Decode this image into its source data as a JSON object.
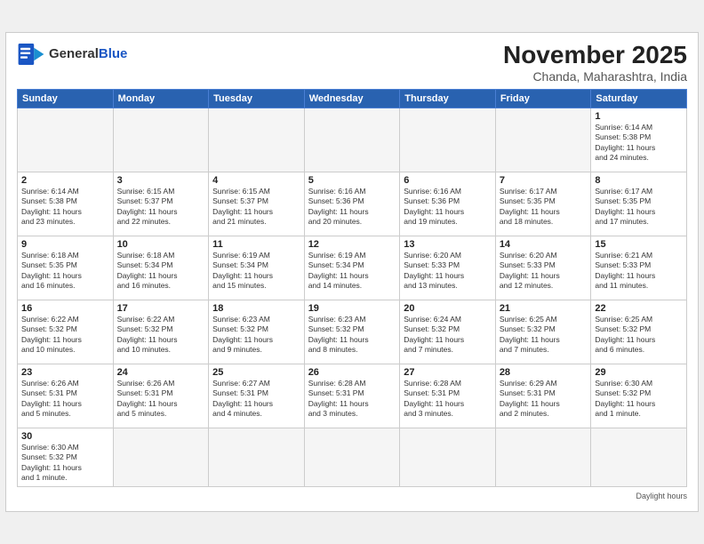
{
  "header": {
    "logo_text_general": "General",
    "logo_text_blue": "Blue",
    "month_title": "November 2025",
    "subtitle": "Chanda, Maharashtra, India"
  },
  "weekdays": [
    "Sunday",
    "Monday",
    "Tuesday",
    "Wednesday",
    "Thursday",
    "Friday",
    "Saturday"
  ],
  "legend": {
    "daylight_hours": "Daylight hours"
  },
  "days": [
    {
      "date": "",
      "info": ""
    },
    {
      "date": "",
      "info": ""
    },
    {
      "date": "",
      "info": ""
    },
    {
      "date": "",
      "info": ""
    },
    {
      "date": "",
      "info": ""
    },
    {
      "date": "",
      "info": ""
    },
    {
      "date": "1",
      "info": "Sunrise: 6:14 AM\nSunset: 5:38 PM\nDaylight: 11 hours\nand 24 minutes."
    },
    {
      "date": "2",
      "info": "Sunrise: 6:14 AM\nSunset: 5:38 PM\nDaylight: 11 hours\nand 23 minutes."
    },
    {
      "date": "3",
      "info": "Sunrise: 6:15 AM\nSunset: 5:37 PM\nDaylight: 11 hours\nand 22 minutes."
    },
    {
      "date": "4",
      "info": "Sunrise: 6:15 AM\nSunset: 5:37 PM\nDaylight: 11 hours\nand 21 minutes."
    },
    {
      "date": "5",
      "info": "Sunrise: 6:16 AM\nSunset: 5:36 PM\nDaylight: 11 hours\nand 20 minutes."
    },
    {
      "date": "6",
      "info": "Sunrise: 6:16 AM\nSunset: 5:36 PM\nDaylight: 11 hours\nand 19 minutes."
    },
    {
      "date": "7",
      "info": "Sunrise: 6:17 AM\nSunset: 5:35 PM\nDaylight: 11 hours\nand 18 minutes."
    },
    {
      "date": "8",
      "info": "Sunrise: 6:17 AM\nSunset: 5:35 PM\nDaylight: 11 hours\nand 17 minutes."
    },
    {
      "date": "9",
      "info": "Sunrise: 6:18 AM\nSunset: 5:35 PM\nDaylight: 11 hours\nand 16 minutes."
    },
    {
      "date": "10",
      "info": "Sunrise: 6:18 AM\nSunset: 5:34 PM\nDaylight: 11 hours\nand 16 minutes."
    },
    {
      "date": "11",
      "info": "Sunrise: 6:19 AM\nSunset: 5:34 PM\nDaylight: 11 hours\nand 15 minutes."
    },
    {
      "date": "12",
      "info": "Sunrise: 6:19 AM\nSunset: 5:34 PM\nDaylight: 11 hours\nand 14 minutes."
    },
    {
      "date": "13",
      "info": "Sunrise: 6:20 AM\nSunset: 5:33 PM\nDaylight: 11 hours\nand 13 minutes."
    },
    {
      "date": "14",
      "info": "Sunrise: 6:20 AM\nSunset: 5:33 PM\nDaylight: 11 hours\nand 12 minutes."
    },
    {
      "date": "15",
      "info": "Sunrise: 6:21 AM\nSunset: 5:33 PM\nDaylight: 11 hours\nand 11 minutes."
    },
    {
      "date": "16",
      "info": "Sunrise: 6:22 AM\nSunset: 5:32 PM\nDaylight: 11 hours\nand 10 minutes."
    },
    {
      "date": "17",
      "info": "Sunrise: 6:22 AM\nSunset: 5:32 PM\nDaylight: 11 hours\nand 10 minutes."
    },
    {
      "date": "18",
      "info": "Sunrise: 6:23 AM\nSunset: 5:32 PM\nDaylight: 11 hours\nand 9 minutes."
    },
    {
      "date": "19",
      "info": "Sunrise: 6:23 AM\nSunset: 5:32 PM\nDaylight: 11 hours\nand 8 minutes."
    },
    {
      "date": "20",
      "info": "Sunrise: 6:24 AM\nSunset: 5:32 PM\nDaylight: 11 hours\nand 7 minutes."
    },
    {
      "date": "21",
      "info": "Sunrise: 6:25 AM\nSunset: 5:32 PM\nDaylight: 11 hours\nand 7 minutes."
    },
    {
      "date": "22",
      "info": "Sunrise: 6:25 AM\nSunset: 5:32 PM\nDaylight: 11 hours\nand 6 minutes."
    },
    {
      "date": "23",
      "info": "Sunrise: 6:26 AM\nSunset: 5:31 PM\nDaylight: 11 hours\nand 5 minutes."
    },
    {
      "date": "24",
      "info": "Sunrise: 6:26 AM\nSunset: 5:31 PM\nDaylight: 11 hours\nand 5 minutes."
    },
    {
      "date": "25",
      "info": "Sunrise: 6:27 AM\nSunset: 5:31 PM\nDaylight: 11 hours\nand 4 minutes."
    },
    {
      "date": "26",
      "info": "Sunrise: 6:28 AM\nSunset: 5:31 PM\nDaylight: 11 hours\nand 3 minutes."
    },
    {
      "date": "27",
      "info": "Sunrise: 6:28 AM\nSunset: 5:31 PM\nDaylight: 11 hours\nand 3 minutes."
    },
    {
      "date": "28",
      "info": "Sunrise: 6:29 AM\nSunset: 5:31 PM\nDaylight: 11 hours\nand 2 minutes."
    },
    {
      "date": "29",
      "info": "Sunrise: 6:30 AM\nSunset: 5:32 PM\nDaylight: 11 hours\nand 1 minute."
    },
    {
      "date": "30",
      "info": "Sunrise: 6:30 AM\nSunset: 5:32 PM\nDaylight: 11 hours\nand 1 minute."
    },
    {
      "date": "",
      "info": ""
    },
    {
      "date": "",
      "info": ""
    },
    {
      "date": "",
      "info": ""
    },
    {
      "date": "",
      "info": ""
    },
    {
      "date": "",
      "info": ""
    },
    {
      "date": "",
      "info": ""
    }
  ]
}
